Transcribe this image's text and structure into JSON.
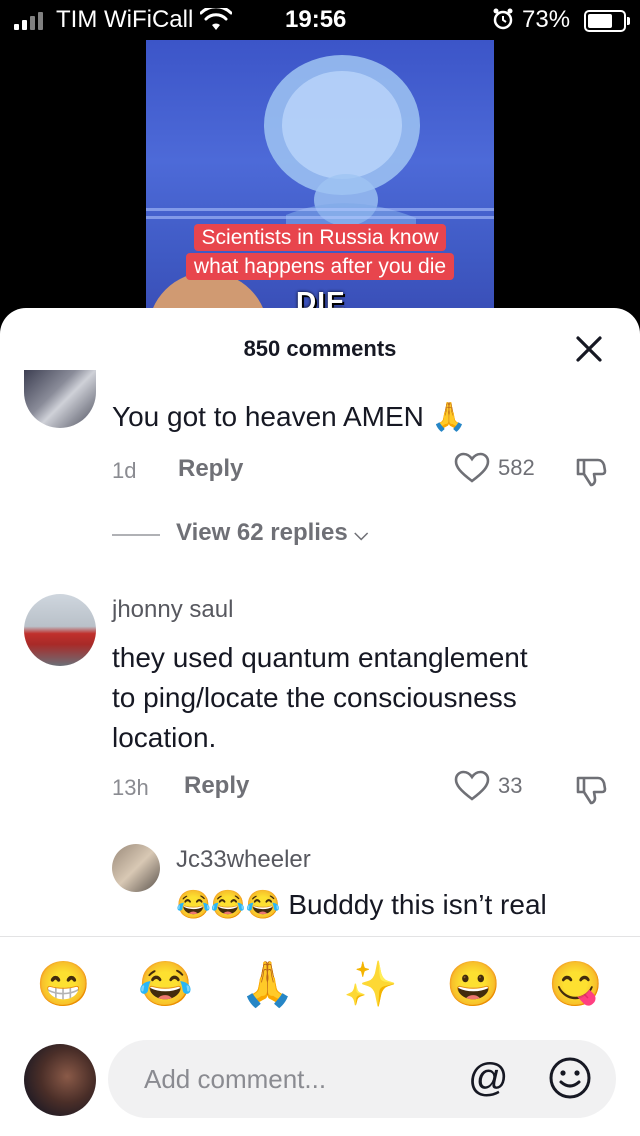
{
  "status_bar": {
    "carrier": "TIM WiFiCall",
    "time": "19:56",
    "battery": "73%"
  },
  "video": {
    "caption_line1": "Scientists in Russia know",
    "caption_line2": "what happens after you die",
    "overlay_text": "DIE"
  },
  "comments_sheet": {
    "title": "850 comments",
    "comments": [
      {
        "text": "You got to heaven AMEN",
        "emoji": "🙏",
        "age": "1d",
        "reply_label": "Reply",
        "likes": "582",
        "view_replies": "View 62 replies"
      },
      {
        "username": "jhonny saul",
        "text_line1": "they used quantum entanglement",
        "text_line2": "to ping/locate the consciousness",
        "text_line3": "location.",
        "age": "13h",
        "reply_label": "Reply",
        "likes": "33"
      },
      {
        "username": "Jc33wheeler",
        "emojis": "😂😂😂",
        "text": "Budddy this isn’t real"
      }
    ],
    "quick_emojis": [
      "😁",
      "😂",
      "🙏",
      "✨",
      "😀",
      "😋"
    ],
    "composer": {
      "placeholder": "Add comment...",
      "at_symbol": "@"
    }
  }
}
